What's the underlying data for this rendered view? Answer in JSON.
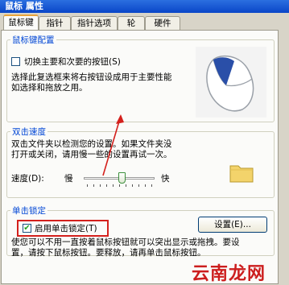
{
  "window": {
    "title": "鼠标 属性"
  },
  "tabs": [
    "鼠标键",
    "指针",
    "指针选项",
    "轮",
    "硬件"
  ],
  "button_config": {
    "legend": "鼠标键配置",
    "switch_label": "切换主要和次要的按钮(S)",
    "switch_checked": false,
    "description_line1": "选择此复选框来将右按钮设成用于主要性能",
    "description_line2": "如选择和拖放之用。"
  },
  "double_click": {
    "legend": "双击速度",
    "description_line1": "双击文件夹以检测您的设置。如果文件夹没",
    "description_line2": "打开或关闭，请用慢一些的设置再试一次。",
    "speed_label": "速度(D):",
    "slow_label": "慢",
    "fast_label": "快",
    "speed_level": 0.55
  },
  "click_lock": {
    "legend": "单击锁定",
    "enable_label": "启用单击锁定(T)",
    "enable_checked": true,
    "settings_button": "设置(E)...",
    "description_line1": "使您可以不用一直按着鼠标按钮就可以突出显示或拖拽。要设",
    "description_line2": "置，请按下鼠标按钮。要释放，请再单击鼠标按钮。"
  },
  "watermark": "云南龙网",
  "colors": {
    "accent": "#0046d5",
    "highlight": "#d4201c",
    "titlebar": "#0a46c8"
  }
}
